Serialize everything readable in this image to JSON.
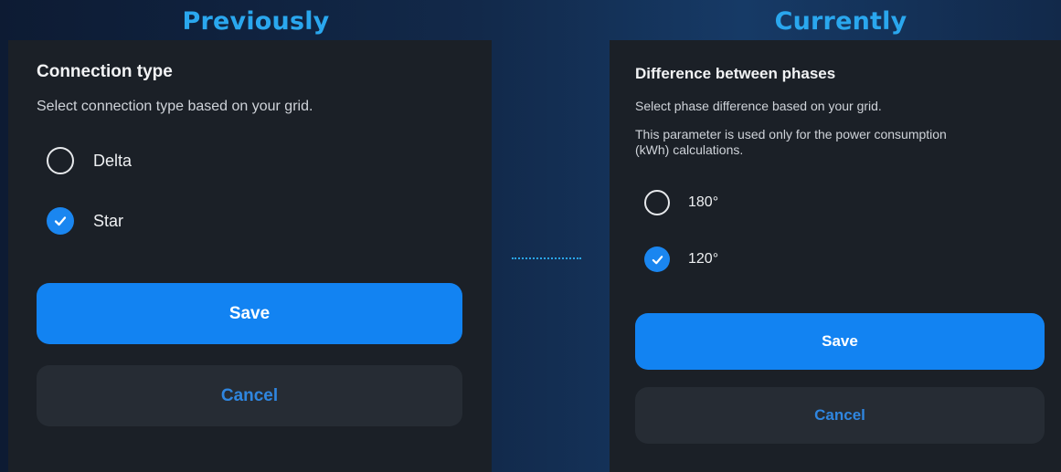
{
  "headings": {
    "previously": "Previously",
    "currently": "Currently"
  },
  "previous": {
    "title": "Connection type",
    "description": "Select connection type based on your grid.",
    "options": [
      {
        "label": "Delta",
        "selected": false
      },
      {
        "label": "Star",
        "selected": true
      }
    ],
    "save_label": "Save",
    "cancel_label": "Cancel"
  },
  "current": {
    "title": "Difference between phases",
    "description": "Select phase difference based on your grid.",
    "note": "This parameter is used only for the power consumption (kWh) calculations.",
    "options": [
      {
        "label": "180°",
        "selected": false
      },
      {
        "label": "120°",
        "selected": true
      }
    ],
    "save_label": "Save",
    "cancel_label": "Cancel"
  },
  "colors": {
    "accent": "#1283f2",
    "heading": "#2aa7ee",
    "panel": "#1b2027",
    "cancel_bg": "#262c34"
  },
  "icons": {
    "selected": "checkmark-icon",
    "unselected": "empty-circle-icon"
  }
}
